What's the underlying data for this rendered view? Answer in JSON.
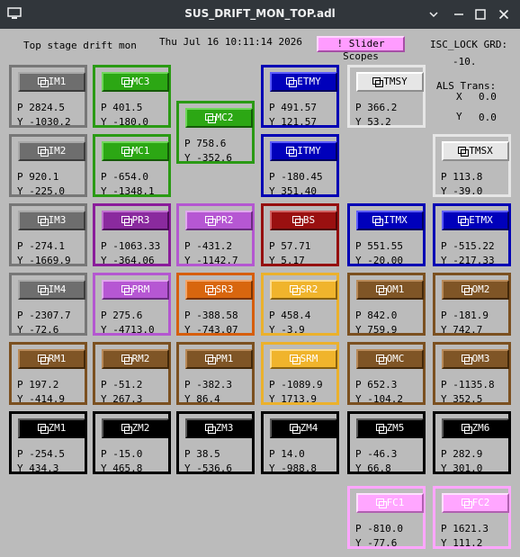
{
  "window": {
    "title": "SUS_DRIFT_MON_TOP.adl"
  },
  "header": {
    "screen_label": "Top stage drift mon",
    "timestamp": "Thu Jul 16 10:11:14 2026",
    "slider_button_label": "! Slider Scopes",
    "isc_lock_label": "ISC_LOCK GRD:",
    "isc_lock_value": "-10.",
    "als_label": "ALS Trans:",
    "als_x_label": "X",
    "als_x_value": "0.0",
    "als_y_label": "Y",
    "als_y_value": "0.0"
  },
  "colors": {
    "background": "#bbbbbb",
    "gray": "#6e6e6e",
    "green": "#2ca714",
    "blue": "#0000bb",
    "white": "#e6e6e6",
    "purple": "#8a2a9e",
    "lavender": "#b657d3",
    "red": "#9a1010",
    "orange": "#d8660e",
    "yellow": "#f0b42c",
    "brown": "#7f5526",
    "black": "#000000",
    "pink": "#ffa6ff"
  },
  "optics": [
    {
      "id": "im1",
      "label": "IM1",
      "p": "P  2824.5",
      "y": "Y  -1030.2"
    },
    {
      "id": "mc3",
      "label": "MC3",
      "p": "P  401.5",
      "y": "Y  -180.0"
    },
    {
      "id": "mc2",
      "label": "MC2",
      "p": "P  758.6",
      "y": "Y  -352.6"
    },
    {
      "id": "etmy",
      "label": "ETMY",
      "p": "P  491.57",
      "y": "Y  121.57"
    },
    {
      "id": "tmsy",
      "label": "TMSY",
      "p": "P  366.2",
      "y": "Y  53.2"
    },
    {
      "id": "im2",
      "label": "IM2",
      "p": "P  920.1",
      "y": "Y  -225.0"
    },
    {
      "id": "mc1",
      "label": "MC1",
      "p": "P  -654.0",
      "y": "Y  -1348.1"
    },
    {
      "id": "itmy",
      "label": "ITMY",
      "p": "P  -180.45",
      "y": "Y  351.40"
    },
    {
      "id": "tmsx",
      "label": "TMSX",
      "p": "P  113.8",
      "y": "Y  -39.0"
    },
    {
      "id": "im3",
      "label": "IM3",
      "p": "P  -274.1",
      "y": "Y  -1669.9"
    },
    {
      "id": "pr3",
      "label": "PR3",
      "p": "P  -1063.33",
      "y": "Y  -364.06"
    },
    {
      "id": "pr2",
      "label": "PR2",
      "p": "P  -431.2",
      "y": "Y  -1142.7"
    },
    {
      "id": "bs",
      "label": "BS",
      "p": "P  57.71",
      "y": "Y  5.17"
    },
    {
      "id": "itmx",
      "label": "ITMX",
      "p": "P  551.55",
      "y": "Y  -20.00"
    },
    {
      "id": "etmx",
      "label": "ETMX",
      "p": "P  -515.22",
      "y": "Y  -217.33"
    },
    {
      "id": "im4",
      "label": "IM4",
      "p": "P  -2307.7",
      "y": "Y  -72.6"
    },
    {
      "id": "prm",
      "label": "PRM",
      "p": "P  275.6",
      "y": "Y  -4713.0"
    },
    {
      "id": "sr3",
      "label": "SR3",
      "p": "P  -388.58",
      "y": "Y  -743.07"
    },
    {
      "id": "sr2",
      "label": "SR2",
      "p": "P  458.4",
      "y": "Y  -3.9"
    },
    {
      "id": "om1",
      "label": "OM1",
      "p": "P  842.0",
      "y": "Y  759.9"
    },
    {
      "id": "om2",
      "label": "OM2",
      "p": "P  -181.9",
      "y": "Y  742.7"
    },
    {
      "id": "rm1",
      "label": "RM1",
      "p": "P  197.2",
      "y": "Y  -414.9"
    },
    {
      "id": "rm2",
      "label": "RM2",
      "p": "P  -51.2",
      "y": "Y  267.3"
    },
    {
      "id": "pm1",
      "label": "PM1",
      "p": "P  -382.3",
      "y": "Y  86.4"
    },
    {
      "id": "srm",
      "label": "SRM",
      "p": "P  -1089.9",
      "y": "Y  1713.9"
    },
    {
      "id": "omc",
      "label": "OMC",
      "p": "P  652.3",
      "y": "Y  -104.2"
    },
    {
      "id": "om3",
      "label": "OM3",
      "p": "P  -1135.8",
      "y": "Y  352.5"
    },
    {
      "id": "zm1",
      "label": "ZM1",
      "p": "P  -254.5",
      "y": "Y  434.3"
    },
    {
      "id": "zm2",
      "label": "ZM2",
      "p": "P  -15.0",
      "y": "Y  465.8"
    },
    {
      "id": "zm3",
      "label": "ZM3",
      "p": "P  38.5",
      "y": "Y  -536.6"
    },
    {
      "id": "zm4",
      "label": "ZM4",
      "p": "P  14.0",
      "y": "Y  -988.8"
    },
    {
      "id": "zm5",
      "label": "ZM5",
      "p": "P  -46.3",
      "y": "Y  66.8"
    },
    {
      "id": "zm6",
      "label": "ZM6",
      "p": "P  282.9",
      "y": "Y  301.0"
    },
    {
      "id": "fc1",
      "label": "FC1",
      "p": "P  -810.0",
      "y": "Y  -77.6"
    },
    {
      "id": "fc2",
      "label": "FC2",
      "p": "P  1621.3",
      "y": "Y  111.2"
    }
  ]
}
